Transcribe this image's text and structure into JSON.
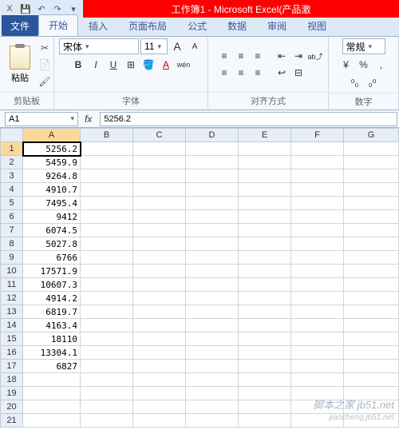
{
  "titlebar": {
    "title": "工作簿1 - Microsoft Excel(产品激"
  },
  "qat": {
    "excel_icon": "X",
    "save": "💾",
    "undo": "↶",
    "redo": "↷",
    "drop": "▾"
  },
  "tabs": {
    "file": "文件",
    "items": [
      "开始",
      "插入",
      "页面布局",
      "公式",
      "数据",
      "审阅",
      "视图"
    ],
    "active_index": 0
  },
  "ribbon": {
    "clipboard": {
      "paste_label": "粘贴",
      "group": "剪贴板",
      "cut": "✂",
      "copy": "📄",
      "brush": "🖌"
    },
    "font": {
      "name": "宋体",
      "size": "11",
      "grow": "A",
      "shrink": "A",
      "bold": "B",
      "italic": "I",
      "underline": "U",
      "border": "⊞",
      "fill": "🪣",
      "color": "A",
      "pinyin": "wén",
      "group": "字体"
    },
    "align": {
      "tl": "≡",
      "tc": "≡",
      "tr": "≡",
      "bl": "≡",
      "bc": "≡",
      "br": "≡",
      "indent_dec": "⇤",
      "indent_inc": "⇥",
      "wrap": "↩",
      "orient": "ab⤴",
      "merge": "⊟",
      "group": "对齐方式"
    },
    "number": {
      "format": "常规",
      "currency": "¥",
      "percent": "%",
      "comma": ",",
      "inc_dec": "⁰₀",
      "dec_dec": "₀⁰",
      "group": "数字"
    }
  },
  "formula_bar": {
    "name_box": "A1",
    "fx": "fx",
    "value": "5256.2"
  },
  "sheet": {
    "columns": [
      "A",
      "B",
      "C",
      "D",
      "E",
      "F",
      "G"
    ],
    "active_col": 0,
    "active_row": 1,
    "rows": [
      {
        "n": 1,
        "v": "5256.2"
      },
      {
        "n": 2,
        "v": "5459.9"
      },
      {
        "n": 3,
        "v": "9264.8"
      },
      {
        "n": 4,
        "v": "4910.7"
      },
      {
        "n": 5,
        "v": "7495.4"
      },
      {
        "n": 6,
        "v": "9412"
      },
      {
        "n": 7,
        "v": "6074.5"
      },
      {
        "n": 8,
        "v": "5027.8"
      },
      {
        "n": 9,
        "v": "6766"
      },
      {
        "n": 10,
        "v": "17571.9"
      },
      {
        "n": 11,
        "v": "10607.3"
      },
      {
        "n": 12,
        "v": "4914.2"
      },
      {
        "n": 13,
        "v": "6819.7"
      },
      {
        "n": 14,
        "v": "4163.4"
      },
      {
        "n": 15,
        "v": "18110"
      },
      {
        "n": 16,
        "v": "13304.1"
      },
      {
        "n": 17,
        "v": "6827"
      },
      {
        "n": 18,
        "v": ""
      },
      {
        "n": 19,
        "v": ""
      },
      {
        "n": 20,
        "v": ""
      },
      {
        "n": 21,
        "v": ""
      }
    ]
  },
  "watermark": {
    "line1": "脚本之家 jb51.net",
    "line2": "jiaocheng.jb51.net"
  }
}
